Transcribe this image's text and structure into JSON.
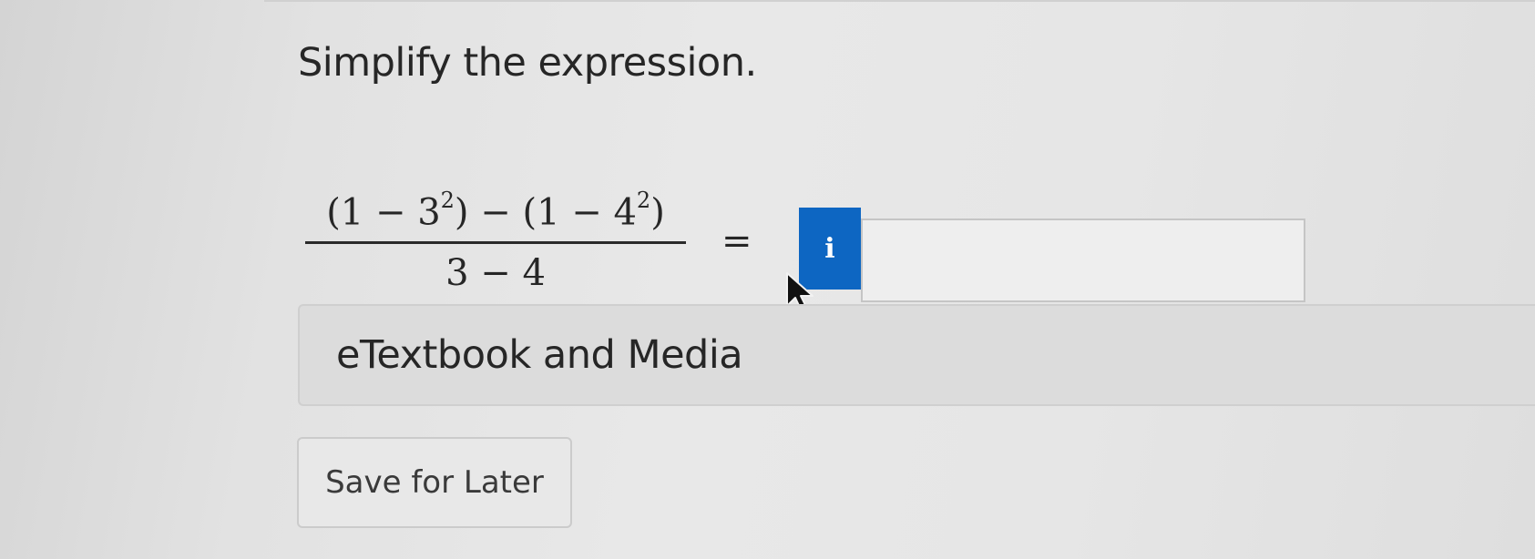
{
  "question": {
    "prompt": "Simplify the expression.",
    "numerator_parts": [
      "(1 − 3",
      "2",
      ") − (1 − 4",
      "2",
      ")"
    ],
    "denominator": "3 − 4",
    "equals": "=",
    "info_badge": "i",
    "answer_value": ""
  },
  "resources": {
    "etextbook_label": "eTextbook and Media"
  },
  "actions": {
    "save_label": "Save for Later"
  },
  "colors": {
    "info_badge": "#0d66c2"
  }
}
